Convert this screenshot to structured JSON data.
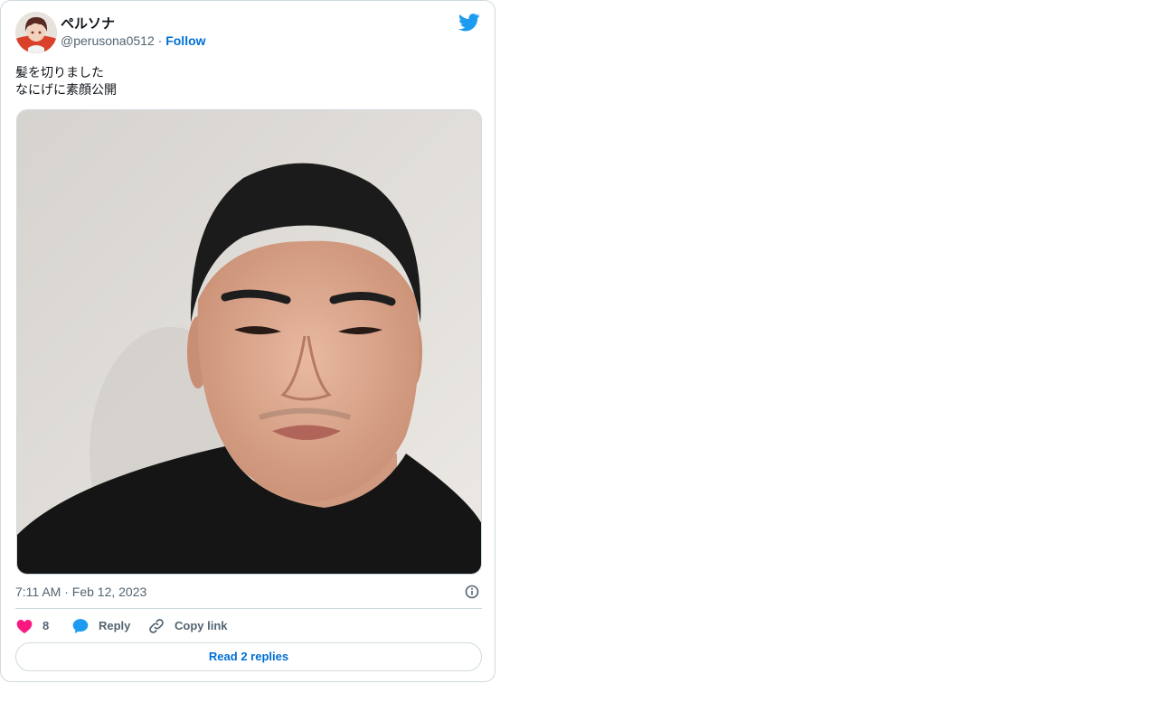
{
  "tweet": {
    "author": {
      "display_name": "ペルソナ",
      "handle": "@perusona0512",
      "separator": "·",
      "follow_label": "Follow",
      "avatar_icon": "anime-avatar-icon"
    },
    "platform_icon": "twitter-bird-icon",
    "text_lines": [
      "髪を切りました",
      "なにげに素顔公開"
    ],
    "media": {
      "kind": "photo",
      "description_icon": "portrait-photo"
    },
    "timestamp": "7:11 AM · Feb 12, 2023",
    "info_icon": "info-circle-icon",
    "actions": {
      "like_count": "8",
      "reply_label": "Reply",
      "copy_label": "Copy link"
    },
    "read_replies_label": "Read 2 replies"
  },
  "colors": {
    "accent": "#006fd6",
    "twitter_blue": "#1d9bf0",
    "like_pink": "#f91880",
    "muted": "#536471",
    "border": "#cfd9de"
  }
}
